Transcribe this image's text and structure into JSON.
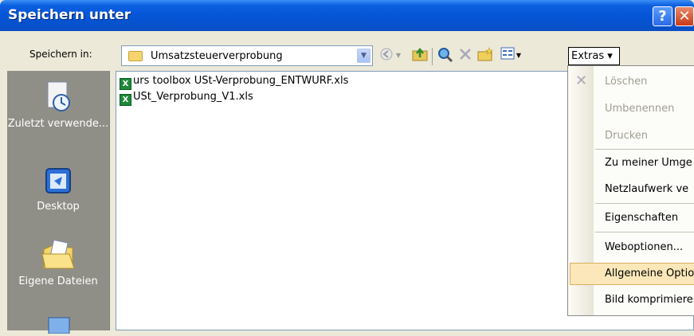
{
  "window": {
    "title": "Speichern unter"
  },
  "titlebar": {
    "help_label": "?",
    "close_label": "✕"
  },
  "toolbar": {
    "save_in_label": "Speichern in:",
    "location": "Umsatzsteuerverprobung",
    "extras_label": "Extras ▾"
  },
  "places": [
    {
      "label": "Zuletzt verwende...",
      "icon": "recent-documents-icon"
    },
    {
      "label": "Desktop",
      "icon": "desktop-icon"
    },
    {
      "label": "Eigene Dateien",
      "icon": "my-documents-icon"
    }
  ],
  "files": [
    {
      "name": "urs toolbox USt-Verprobung_ENTWURF.xls",
      "icon": "excel-file-icon"
    },
    {
      "name": "USt_Verprobung_V1.xls",
      "icon": "excel-file-icon"
    }
  ],
  "extras_menu": {
    "items": [
      {
        "label": "Löschen",
        "disabled": true
      },
      {
        "label": "Umbenennen",
        "disabled": true
      },
      {
        "label": "Drucken",
        "disabled": true
      },
      {
        "label": "Zu meiner Umge",
        "disabled": false
      },
      {
        "label": "Netzlaufwerk ve",
        "disabled": false
      },
      {
        "label": "Eigenschaften",
        "disabled": false
      },
      {
        "label": "Weboptionen...",
        "disabled": false
      },
      {
        "label": "Allgemeine Optio",
        "disabled": false,
        "highlighted": true
      },
      {
        "label": "Bild komprimierer",
        "disabled": false
      }
    ]
  },
  "colors": {
    "titlebar": "#0454d4",
    "dialog": "#ece9d8",
    "places_bar": "#908f87",
    "highlight": "#fbe7b9"
  }
}
